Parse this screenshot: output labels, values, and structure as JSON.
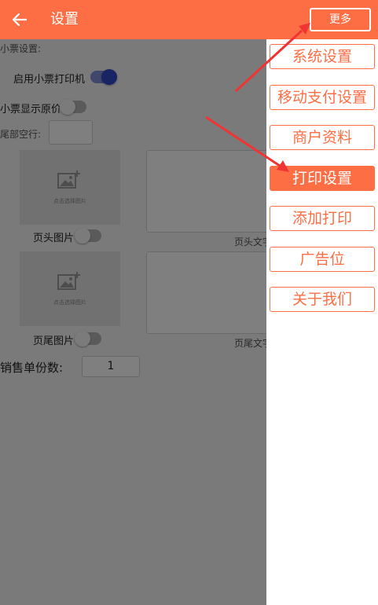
{
  "header": {
    "title": "设置",
    "more_label": "更多",
    "color": "#fe6e44"
  },
  "content": {
    "receipt_section_label": "小票设置:",
    "enable_printer_label": "启用小票打印机",
    "enable_printer_on": true,
    "show_original_price_label": "小票显示原价",
    "show_original_price_on": false,
    "tail_blank_label": "尾部空行:",
    "tail_blank_value": "",
    "header_image": {
      "picker_text": "点击选择图片",
      "toggle_label": "页头图片",
      "toggle_on": false,
      "text_caption": "页头文字"
    },
    "footer_image": {
      "picker_text": "点击选择图片",
      "toggle_label": "页尾图片",
      "toggle_on": false,
      "text_caption": "页尾文字"
    },
    "sales_copies_label": "销售单份数:",
    "sales_copies_value": "1"
  },
  "menu": {
    "items": [
      {
        "label": "系统设置",
        "active": false
      },
      {
        "label": "移动支付设置",
        "active": false
      },
      {
        "label": "商户资料",
        "active": false
      },
      {
        "label": "打印设置",
        "active": true
      },
      {
        "label": "添加打印",
        "active": false
      },
      {
        "label": "广告位",
        "active": false
      },
      {
        "label": "关于我们",
        "active": false
      }
    ]
  },
  "colors": {
    "accent": "#fe6e44",
    "arrow": "#f03434",
    "toggle_on": "#3049c6"
  },
  "icons": {
    "back": "arrow-left-icon",
    "image_placeholder": "image-add-icon"
  }
}
